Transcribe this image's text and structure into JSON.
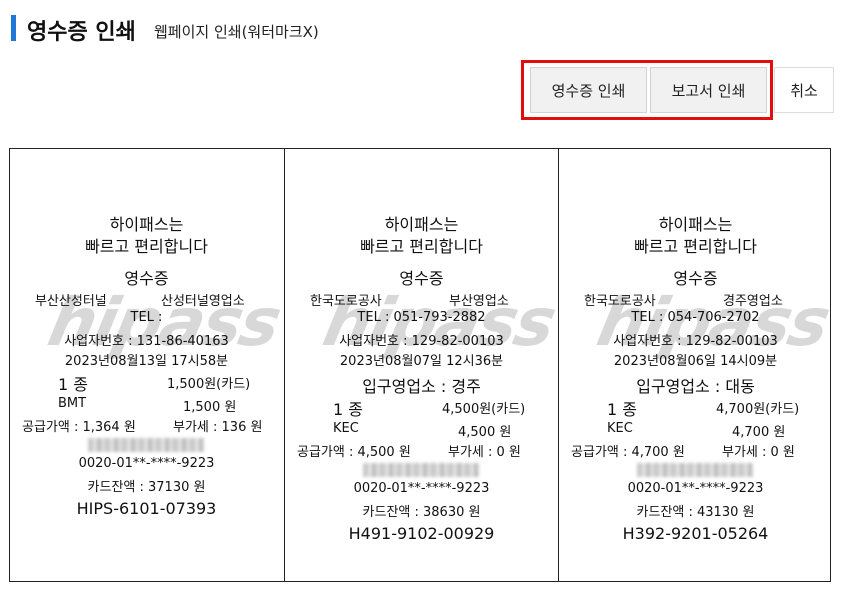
{
  "header": {
    "title": "영수증 인쇄",
    "subtitle": "웹페이지 인쇄(워터마크X)"
  },
  "buttons": {
    "print_receipt": "영수증 인쇄",
    "print_report": "보고서 인쇄",
    "cancel": "취소"
  },
  "watermark": "hipass",
  "receipts": [
    {
      "slogan_1": "하이패스는",
      "slogan_2": "빠르고 편리합니다",
      "doc_title": "영수증",
      "company": "부산산성터널",
      "office": "산성터널영업소",
      "tel": "TEL :",
      "biz_no": "사업자번호 : 131-86-40163",
      "datetime": "2023년08월13일 17시58분",
      "entry_office": "",
      "class": "1 종",
      "amount": "1,500원(카드)",
      "card_type": "BMT",
      "card_amount": "1,500 원",
      "supply": "공급가액 : 1,364 원",
      "vat": "부가세 : 136 원",
      "card_no": "0020-01**-****-9223",
      "balance": "카드잔액 : 37130 원",
      "approval": "HIPS-6101-07393"
    },
    {
      "slogan_1": "하이패스는",
      "slogan_2": "빠르고 편리합니다",
      "doc_title": "영수증",
      "company": "한국도로공사",
      "office": "부산영업소",
      "tel": "TEL : 051-793-2882",
      "biz_no": "사업자번호 : 129-82-00103",
      "datetime": "2023년08월07일 12시36분",
      "entry_office": "입구영업소 : 경주",
      "class": "1 종",
      "amount": "4,500원(카드)",
      "card_type": "KEC",
      "card_amount": "4,500 원",
      "supply": "공급가액 : 4,500 원",
      "vat": "부가세 : 0 원",
      "card_no": "0020-01**-****-9223",
      "balance": "카드잔액 : 38630 원",
      "approval": "H491-9102-00929"
    },
    {
      "slogan_1": "하이패스는",
      "slogan_2": "빠르고 편리합니다",
      "doc_title": "영수증",
      "company": "한국도로공사",
      "office": "경주영업소",
      "tel": "TEL : 054-706-2702",
      "biz_no": "사업자번호 : 129-82-00103",
      "datetime": "2023년08월06일 14시09분",
      "entry_office": "입구영업소 : 대동",
      "class": "1 종",
      "amount": "4,700원(카드)",
      "card_type": "KEC",
      "card_amount": "4,700 원",
      "supply": "공급가액 : 4,700 원",
      "vat": "부가세 : 0 원",
      "card_no": "0020-01**-****-9223",
      "balance": "카드잔액 : 43130 원",
      "approval": "H392-9201-05264"
    }
  ]
}
